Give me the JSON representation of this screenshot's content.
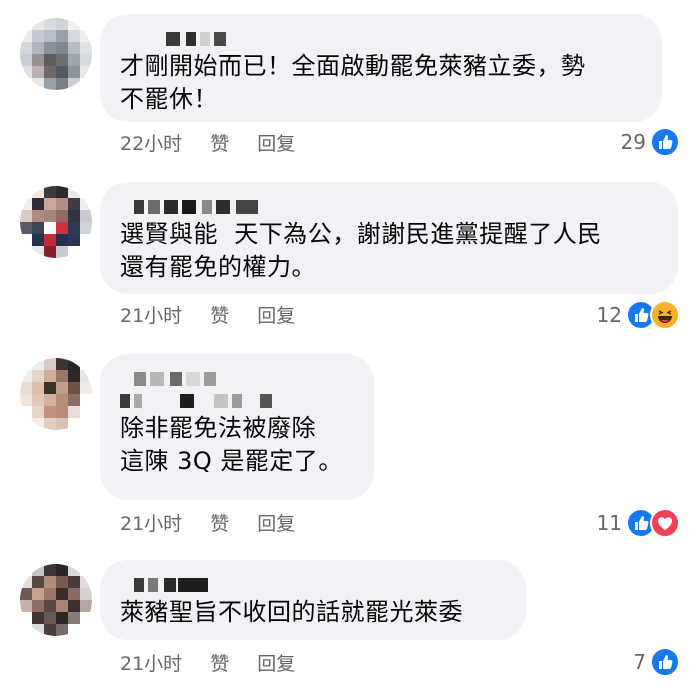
{
  "comments": [
    {
      "author": "",
      "text": "才剛開始而已！全面啟動罷免萊豬立委，勢\n不罷休！",
      "time": "22小时",
      "like_label": "赞",
      "reply_label": "回复",
      "reaction_count": "29",
      "reactions": [
        "like"
      ]
    },
    {
      "author": "",
      "text": "選賢與能  天下為公，謝謝民進黨提醒了人民\n還有罷免的權力。",
      "time": "21小时",
      "like_label": "赞",
      "reply_label": "回复",
      "reaction_count": "12",
      "reactions": [
        "like",
        "haha"
      ]
    },
    {
      "author": "",
      "text": "除非罷免法被廢除\n這陳 3Q 是罷定了。",
      "time": "21小时",
      "like_label": "赞",
      "reply_label": "回复",
      "reaction_count": "11",
      "reactions": [
        "like",
        "love"
      ]
    },
    {
      "author": "",
      "text": "萊豬聖旨不收回的話就罷光萊委",
      "time": "21小时",
      "like_label": "赞",
      "reply_label": "回复",
      "reaction_count": "7",
      "reactions": [
        "like"
      ]
    }
  ],
  "colors": {
    "bubble": "#f0f2f5",
    "meta_text": "#65676b",
    "like_blue": "#1877f2",
    "love_red": "#f33e58",
    "haha_yellow": "#f7b125"
  }
}
